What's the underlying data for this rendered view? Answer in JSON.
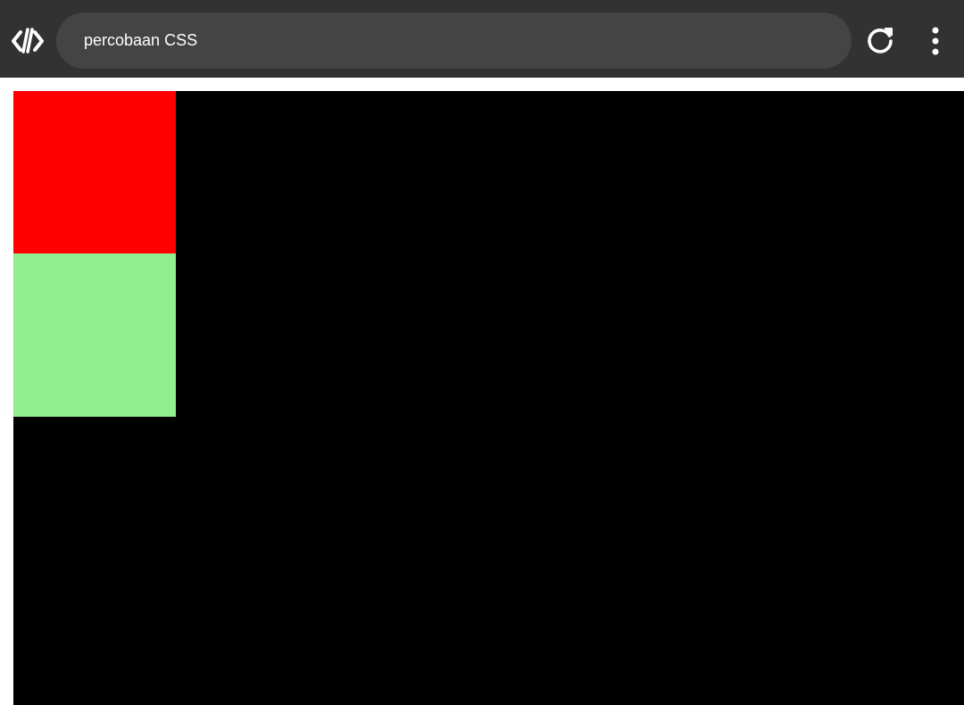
{
  "toolbar": {
    "logo_icon": "code-brackets-icon",
    "address_text": "percobaan CSS",
    "reload_icon": "reload-icon",
    "menu_icon": "more-vertical-icon"
  },
  "page": {
    "canvas_color": "#000000",
    "boxes": [
      {
        "name": "red-box",
        "color": "#ff0000"
      },
      {
        "name": "light-green-box",
        "color": "#90ee90"
      }
    ]
  }
}
